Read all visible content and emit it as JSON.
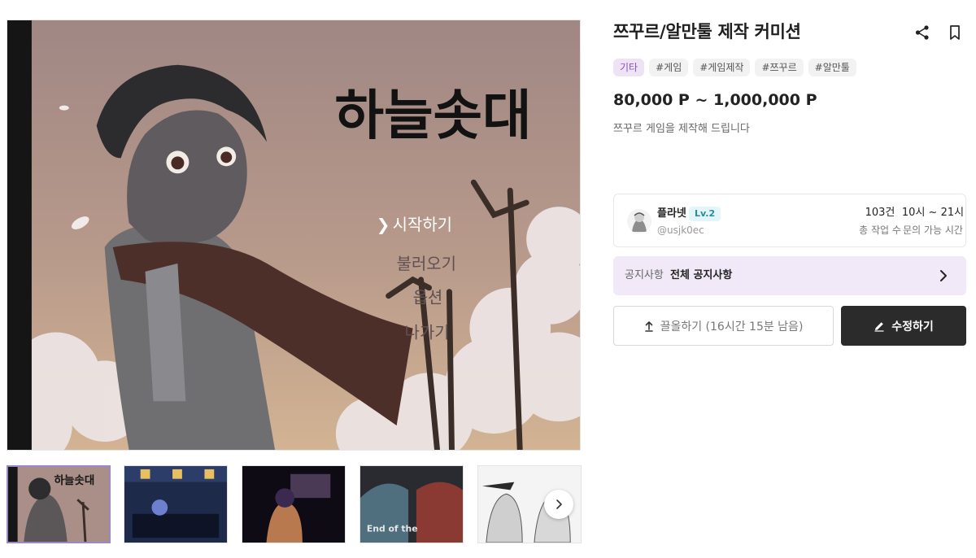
{
  "product": {
    "title": "쯔꾸르/알만툴 제작 커미션",
    "tags": [
      "기타",
      "#게임",
      "#게임제작",
      "#쯔꾸르",
      "#알만툴"
    ],
    "price": "80,000 P ~ 1,000,000 P",
    "description": "쯔꾸르 게임을 제작해 드립니다"
  },
  "gallery": {
    "main": {
      "game_title": "하늘솟대",
      "menu": [
        "시작하기",
        "불러오기",
        "옵션",
        "나가기"
      ],
      "menu_cursor": "❯"
    },
    "thumbnails": [
      {
        "caption": "하늘솟대"
      },
      {
        "caption": ""
      },
      {
        "caption": ""
      },
      {
        "caption": "End of the"
      },
      {
        "caption": ""
      }
    ],
    "next_icon": "chevron-right-icon"
  },
  "seller": {
    "name": "플라넷",
    "level": "Lv.2",
    "handle": "@usjk0ec",
    "works_value": "103건",
    "works_label": "총 작업 수",
    "hours_value": "10시 ~ 21시",
    "hours_label": "문의 가능 시간"
  },
  "notice": {
    "label": "공지사항",
    "text": "전체 공지사항"
  },
  "actions": {
    "bump_label": "끌올하기 (16시간 15분 남음)",
    "edit_label": "수정하기"
  },
  "colors": {
    "tag_primary_bg": "#eee3f5",
    "tag_primary_text": "#8a53b0",
    "notice_bg": "#f1e9f7",
    "level_badge_bg": "#e2f6f9",
    "edit_button_bg": "#2b2b2b"
  }
}
